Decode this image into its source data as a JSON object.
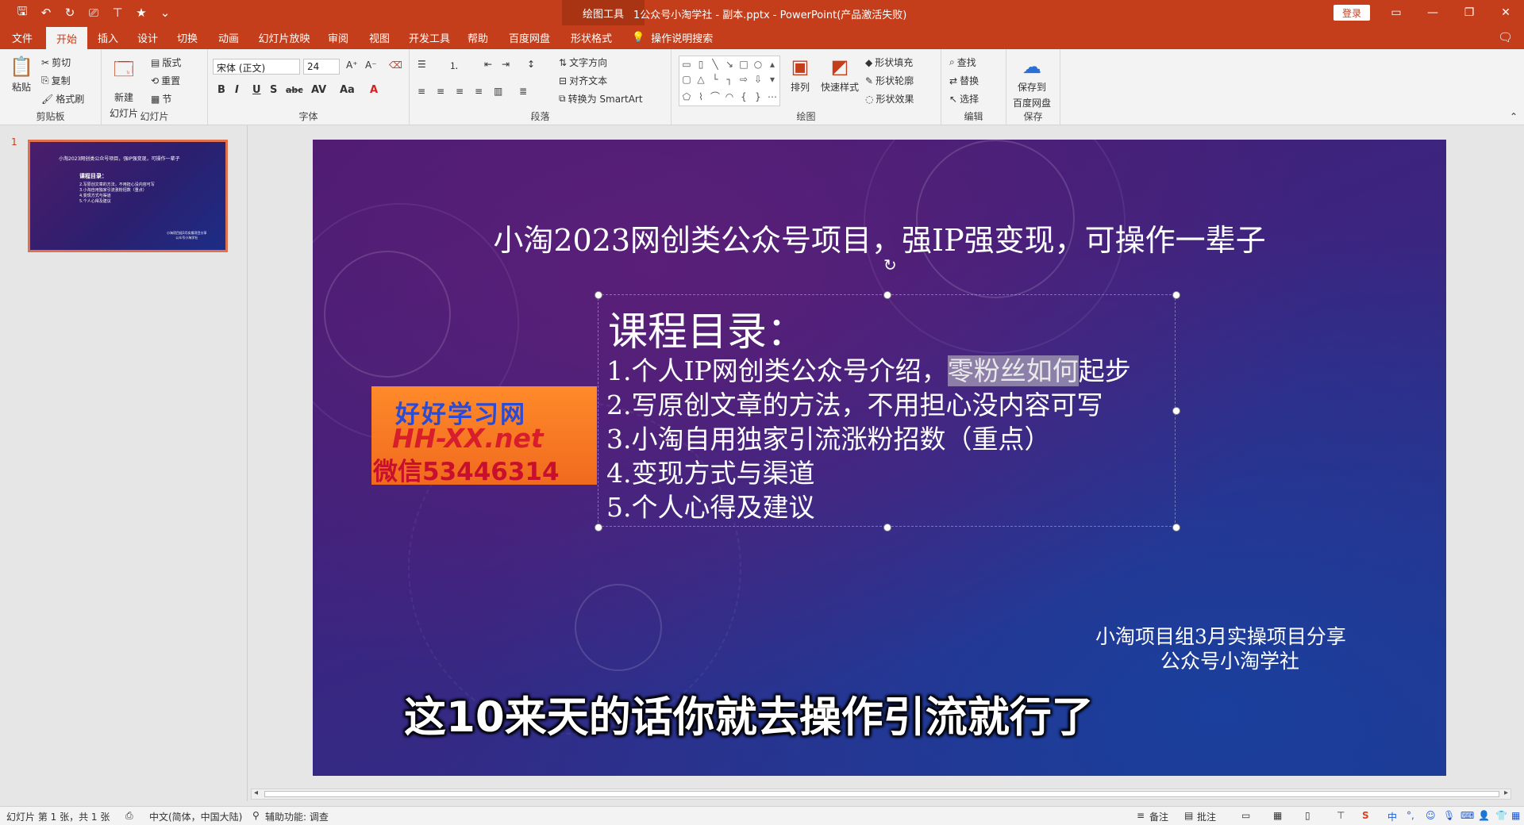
{
  "titlebar": {
    "context_tool": "绘图工具",
    "doc_title": "1公众号小淘学社 - 副本.pptx  -  PowerPoint(产品激活失败)",
    "login": "登录"
  },
  "tabs": [
    "文件",
    "开始",
    "插入",
    "设计",
    "切换",
    "动画",
    "幻灯片放映",
    "审阅",
    "视图",
    "开发工具",
    "帮助",
    "百度网盘",
    "形状格式"
  ],
  "active_tab": "开始",
  "tell_me": "操作说明搜索",
  "ribbon": {
    "clipboard": {
      "label": "剪贴板",
      "paste": "粘贴",
      "cut": "剪切",
      "copy": "复制",
      "painter": "格式刷"
    },
    "slides": {
      "label": "幻灯片",
      "new_slide": "新建",
      "new_slide2": "幻灯片",
      "layout": "版式",
      "reset": "重置",
      "section": "节"
    },
    "font": {
      "label": "字体",
      "name": "宋体 (正文)",
      "size": "24"
    },
    "paragraph": {
      "label": "段落",
      "text_dir": "文字方向",
      "align_text": "对齐文本",
      "smartart": "转换为 SmartArt"
    },
    "drawing": {
      "label": "绘图",
      "arrange": "排列",
      "quick_styles": "快速样式",
      "fill": "形状填充",
      "outline": "形状轮廓",
      "effects": "形状效果"
    },
    "editing": {
      "label": "编辑",
      "find": "查找",
      "replace": "替换",
      "select": "选择"
    },
    "save": {
      "label": "保存",
      "btn1": "保存到",
      "btn2": "百度网盘"
    }
  },
  "thumbnail": {
    "number": "1"
  },
  "slide": {
    "title": "小淘2023网创类公众号项目，强IP强变现，可操作一辈子",
    "toc_heading": "课程目录：",
    "item1_pre": "1.个人IP网创类公众号介绍，",
    "item1_hl": "零粉丝如何",
    "item1_post": "起步",
    "item2": "2.写原创文章的方法，不用担心没内容可写",
    "item3": "3.小淘自用独家引流涨粉招数（重点）",
    "item4": "4.变现方式与渠道",
    "item5": "5.个人心得及建议",
    "credit1": "小淘项目组3月实操项目分享",
    "credit2": "公众号小淘学社"
  },
  "watermark": {
    "line1": "好好学习网",
    "line2": "HH-XX.net",
    "line3": "微信53446314"
  },
  "subtitle": "这10来天的话你就去操作引流就行了",
  "status": {
    "slide_info": "幻灯片 第 1 张，共 1 张",
    "language": "中文(简体，中国大陆)",
    "accessibility": "辅助功能: 调查",
    "notes": "备注",
    "comments": "批注"
  }
}
